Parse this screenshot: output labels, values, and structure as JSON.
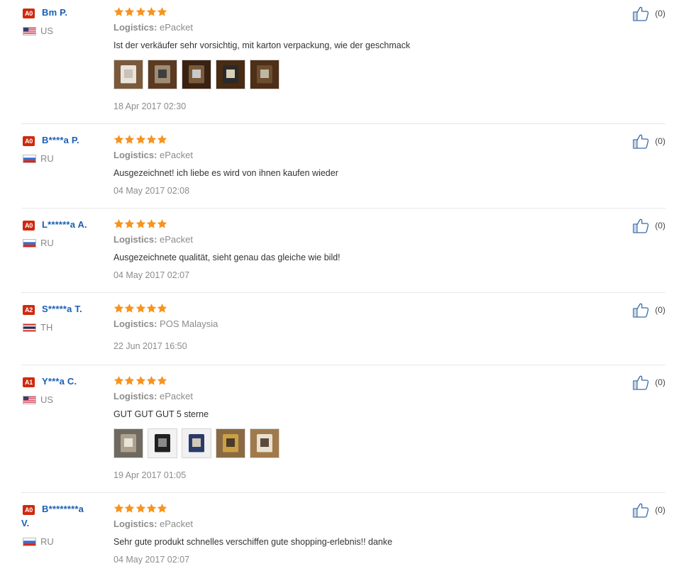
{
  "reviews": [
    {
      "level": "A0",
      "user_name": "Bm P.",
      "country_code": "US",
      "rating": 5,
      "logistics_label": "Logistics:",
      "logistics": "ePacket",
      "text": "Ist der verkäufer sehr vorsichtig, mit karton verpackung, wie der geschmack",
      "photos": [
        "photo-box-white",
        "photo-box-open",
        "photo-product-dark",
        "photo-product-case",
        "photo-product-brown"
      ],
      "date": "18 Apr 2017 02:30",
      "helpful_count": "(0)"
    },
    {
      "level": "A0",
      "user_name": "B****a P.",
      "country_code": "RU",
      "rating": 5,
      "logistics_label": "Logistics:",
      "logistics": "ePacket",
      "text": "Ausgezeichnet! ich liebe es wird von ihnen kaufen wieder",
      "photos": [],
      "date": "04 May 2017 02:08",
      "helpful_count": "(0)"
    },
    {
      "level": "A0",
      "user_name": "L******a A.",
      "country_code": "RU",
      "rating": 5,
      "logistics_label": "Logistics:",
      "logistics": "ePacket",
      "text": "Ausgezeichnete qualität, sieht genau das gleiche wie bild!",
      "photos": [],
      "date": "04 May 2017 02:07",
      "helpful_count": "(0)"
    },
    {
      "level": "A2",
      "user_name": "S*****a T.",
      "country_code": "TH",
      "rating": 5,
      "logistics_label": "Logistics:",
      "logistics": "POS Malaysia",
      "text": "",
      "photos": [],
      "date": "22 Jun 2017 16:50",
      "helpful_count": "(0)"
    },
    {
      "level": "A1",
      "user_name": "Y***a C.",
      "country_code": "US",
      "rating": 5,
      "logistics_label": "Logistics:",
      "logistics": "ePacket",
      "text": "GUT GUT GUT 5 sterne",
      "photos": [
        "photo-product-hand",
        "photo-product-watch",
        "photo-product-blue",
        "photo-product-cable",
        "photo-package-label"
      ],
      "date": "19 Apr 2017 01:05",
      "helpful_count": "(0)"
    },
    {
      "level": "A0",
      "user_name": "B********a V.",
      "country_code": "RU",
      "rating": 5,
      "logistics_label": "Logistics:",
      "logistics": "ePacket",
      "text": "Sehr gute produkt schnelles verschiffen gute shopping-erlebnis!! danke",
      "photos": [],
      "date": "04 May 2017 02:07",
      "helpful_count": "(0)"
    }
  ],
  "colors": {
    "username": "#1a5fb4",
    "level_badge": "#d0290e",
    "star": "#f7931e",
    "muted_text": "#8c8c8c",
    "divider": "#e8e8e8"
  },
  "icons": {
    "rating_star": "star-icon",
    "helpful": "thumbs-up-icon",
    "flag_us": "us-flag-icon",
    "flag_ru": "ru-flag-icon",
    "flag_th": "th-flag-icon"
  }
}
